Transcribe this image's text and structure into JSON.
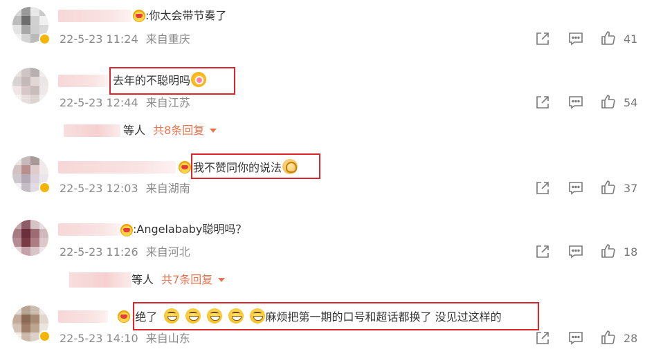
{
  "comments": [
    {
      "text": ":你太会带节奏了",
      "date": "22-5-23 11:24",
      "location": "来自重庆",
      "likes": "41"
    },
    {
      "text": "去年的不聪明吗",
      "date": "22-5-23 12:44",
      "location": "来自江苏",
      "likes": "54",
      "reply": {
        "who": "等人",
        "link": "共8条回复"
      }
    },
    {
      "text": "我不赞同你的说法",
      "date": "22-5-23 12:03",
      "location": "来自湖南",
      "likes": "37"
    },
    {
      "text": ":Angelababy聪明吗？",
      "date": "22-5-23 11:26",
      "location": "来自河北",
      "likes": "18",
      "reply": {
        "who": "等人",
        "link": "共7条回复"
      }
    },
    {
      "text_before": ":绝了",
      "text_after": "麻烦把第一期的口号和超话都换了 没见过这样的",
      "date": "22-5-23 14:10",
      "location": "来自山东",
      "likes": "28"
    }
  ],
  "icons": {
    "share": "share-icon",
    "comment": "comment-icon",
    "like": "thumbs-up-icon"
  },
  "colors": {
    "highlight": "#e0242b",
    "reply_link": "#eb7350",
    "meta": "#8a8a8a"
  }
}
